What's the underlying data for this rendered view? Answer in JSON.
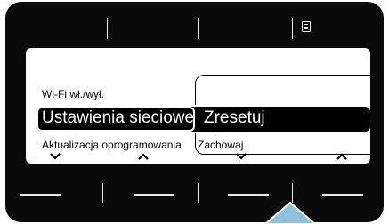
{
  "menu": {
    "row1_label": "Wi-Fi wł./wył.",
    "row2_label": "Ustawienia sieciowe",
    "row2_value": "Zresetuj",
    "row3_label": "Aktualizacja oprogramowania",
    "row3_value": "Zachowaj"
  },
  "icons": {
    "top_right": "menu-list-icon",
    "nav": [
      "chevron-down-icon",
      "chevron-up-icon",
      "chevron-down-icon",
      "chevron-up-icon"
    ],
    "pointer": "arrow-up-icon"
  },
  "colors": {
    "bezel": "#0a0a0a",
    "screen": "#ffffff",
    "pointer": "#8fc0dc"
  }
}
